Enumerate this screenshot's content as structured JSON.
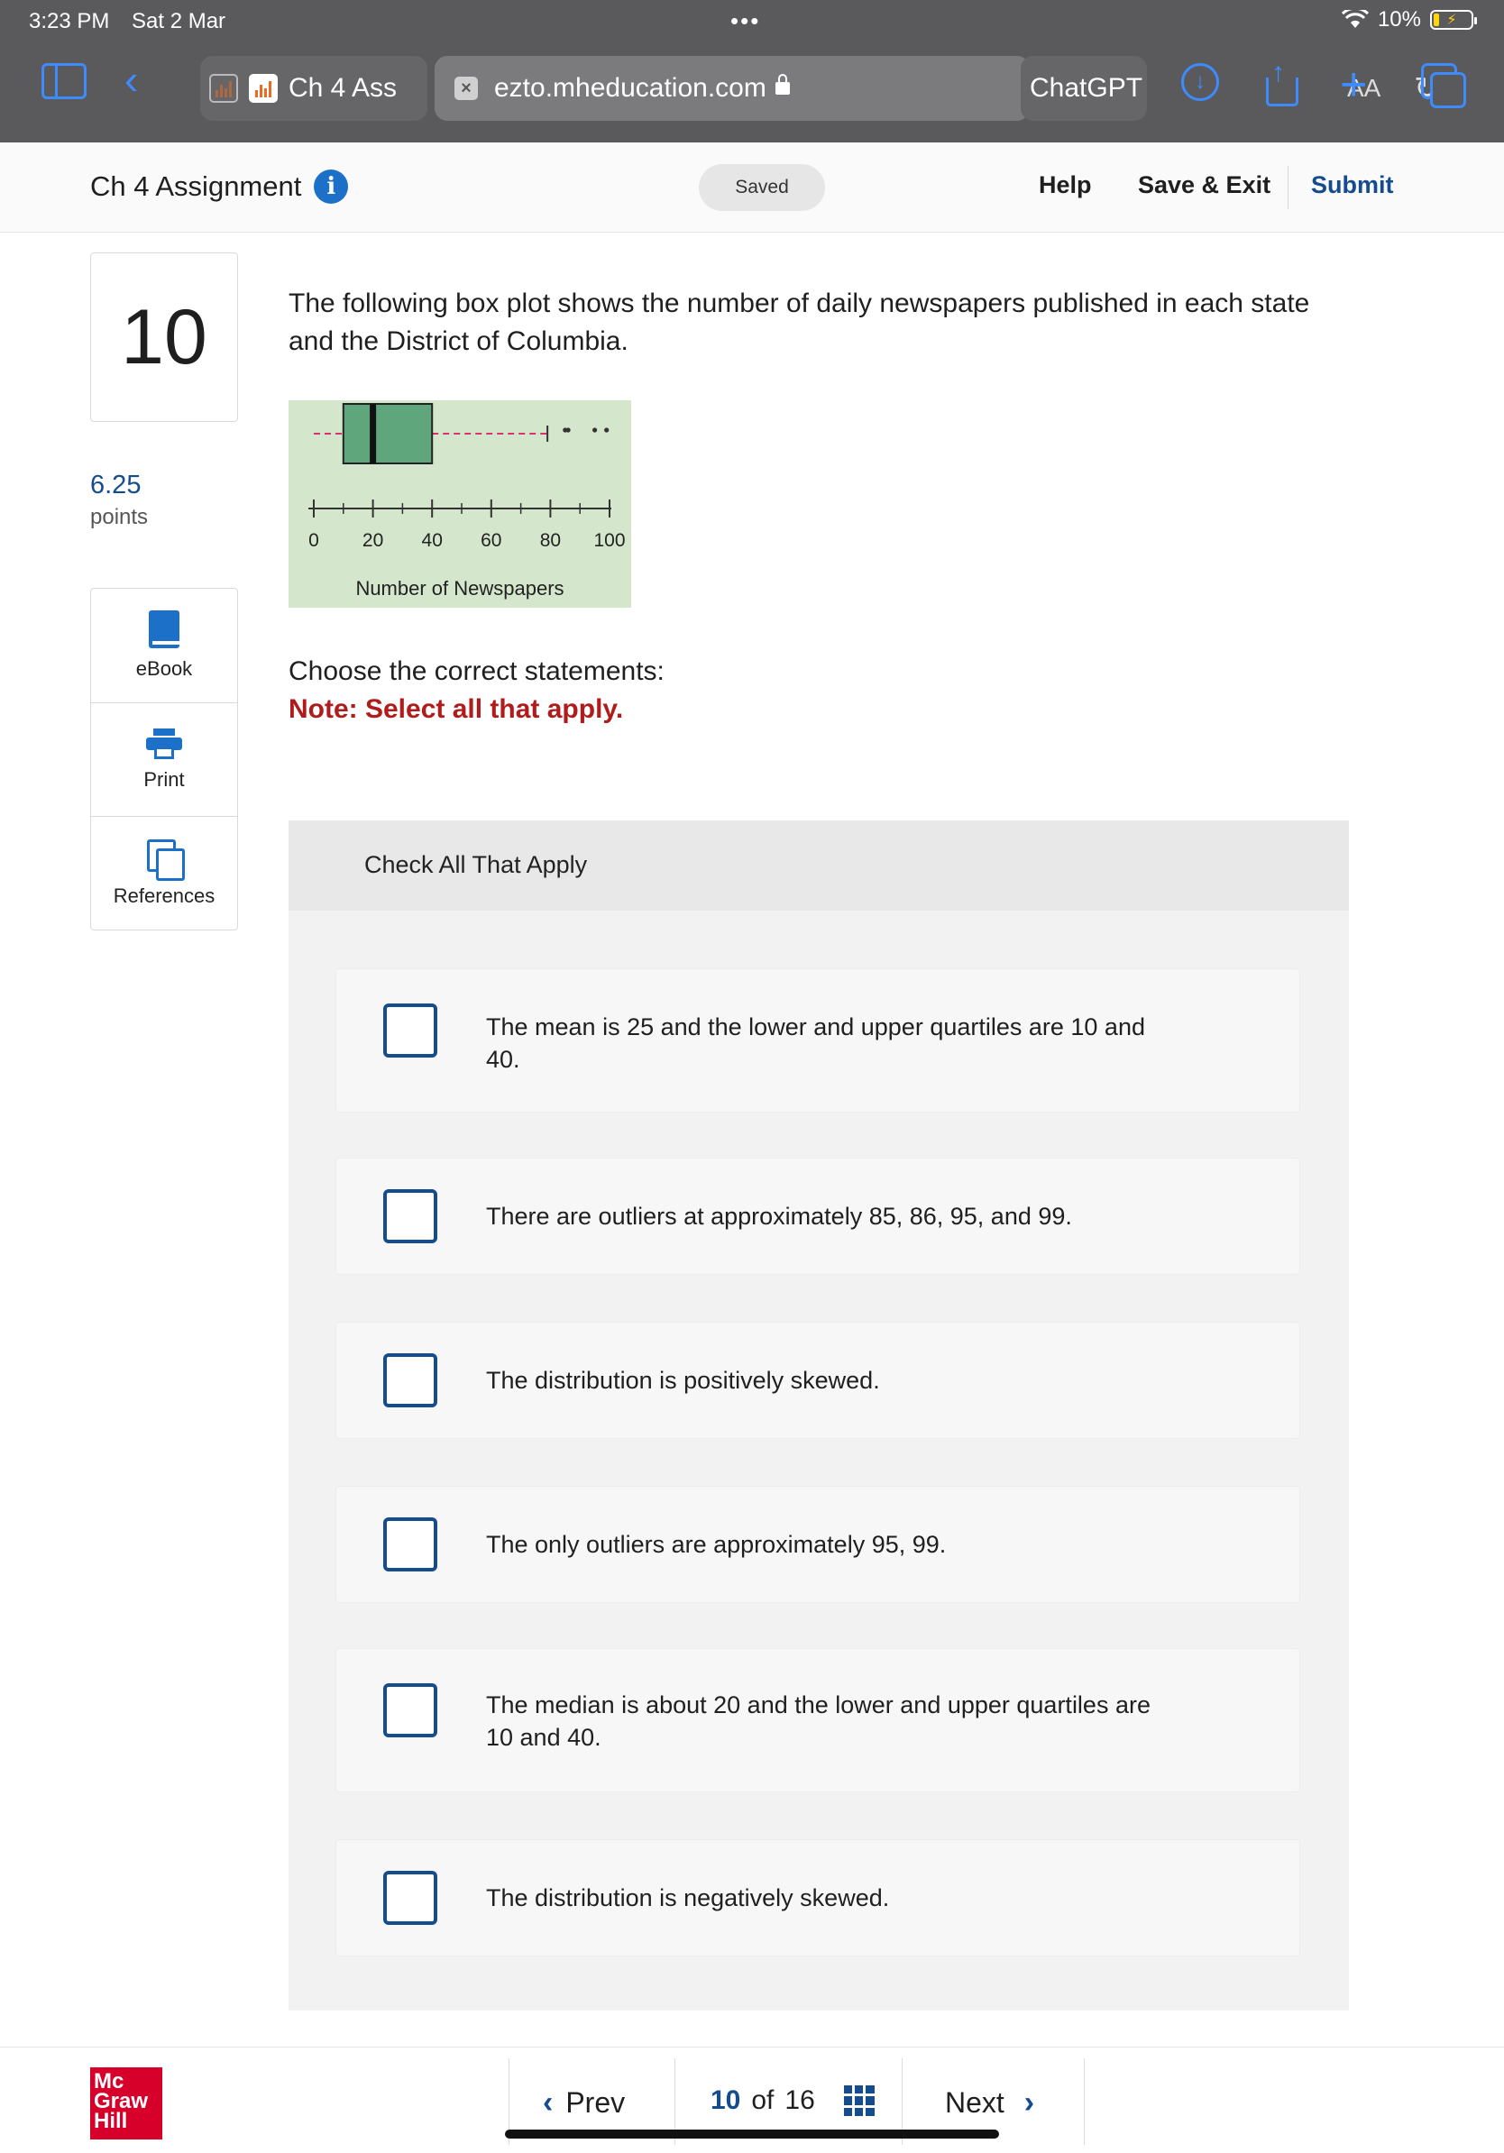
{
  "status_bar": {
    "time": "3:23 PM",
    "date": "Sat 2 Mar",
    "dots": "•••",
    "wifi_icon": "wifi-icon",
    "battery_percent": "10%"
  },
  "browser": {
    "tab_title": "Ch 4 Ass",
    "url": "ezto.mheducation.com",
    "text_size": "AA",
    "other_tab": "ChatGPT",
    "accent_color": "#3d8bfd"
  },
  "header": {
    "title": "Ch 4 Assignment",
    "saved": "Saved",
    "help": "Help",
    "save_exit": "Save & Exit",
    "submit": "Submit"
  },
  "sidebar": {
    "question_number": "10",
    "points_value": "6.25",
    "points_label": "points",
    "tools": [
      {
        "label": "eBook",
        "icon": "book-icon"
      },
      {
        "label": "Print",
        "icon": "printer-icon"
      },
      {
        "label": "References",
        "icon": "references-icon"
      }
    ]
  },
  "question": {
    "prompt": "The following box plot shows the number of daily newspapers published in each state and the District of Columbia.",
    "choose": "Choose the correct statements:",
    "note": "Note: Select all that apply."
  },
  "chart_data": {
    "type": "box",
    "xlabel": "Number of Newspapers",
    "xlim": [
      0,
      100
    ],
    "ticks": [
      "0",
      "20",
      "40",
      "60",
      "80",
      "100"
    ],
    "box": {
      "whisker_low": 0,
      "q1": 10,
      "median": 20,
      "q3": 40,
      "whisker_high": 79
    },
    "outliers": [
      85,
      86,
      95,
      99
    ],
    "box_color": "#5fa67d",
    "whisker_color": "#d6336c",
    "background": "#d4e6cc"
  },
  "answers": {
    "heading": "Check All That Apply",
    "options": [
      {
        "text": "The mean is 25 and the lower and upper quartiles are 10 and 40.",
        "checked": false
      },
      {
        "text": "There are outliers at approximately 85, 86, 95, and 99.",
        "checked": false
      },
      {
        "text": "The distribution is positively skewed.",
        "checked": false
      },
      {
        "text": "The only outliers are approximately 95, 99.",
        "checked": false
      },
      {
        "text": "The median is about 20 and the lower and upper quartiles are 10 and 40.",
        "checked": false
      },
      {
        "text": "The distribution is negatively skewed.",
        "checked": false
      }
    ]
  },
  "footer": {
    "logo_lines": [
      "Mc",
      "Graw",
      "Hill"
    ],
    "prev": "Prev",
    "current_page": "10",
    "of": "of",
    "total_pages": "16",
    "next": "Next"
  }
}
